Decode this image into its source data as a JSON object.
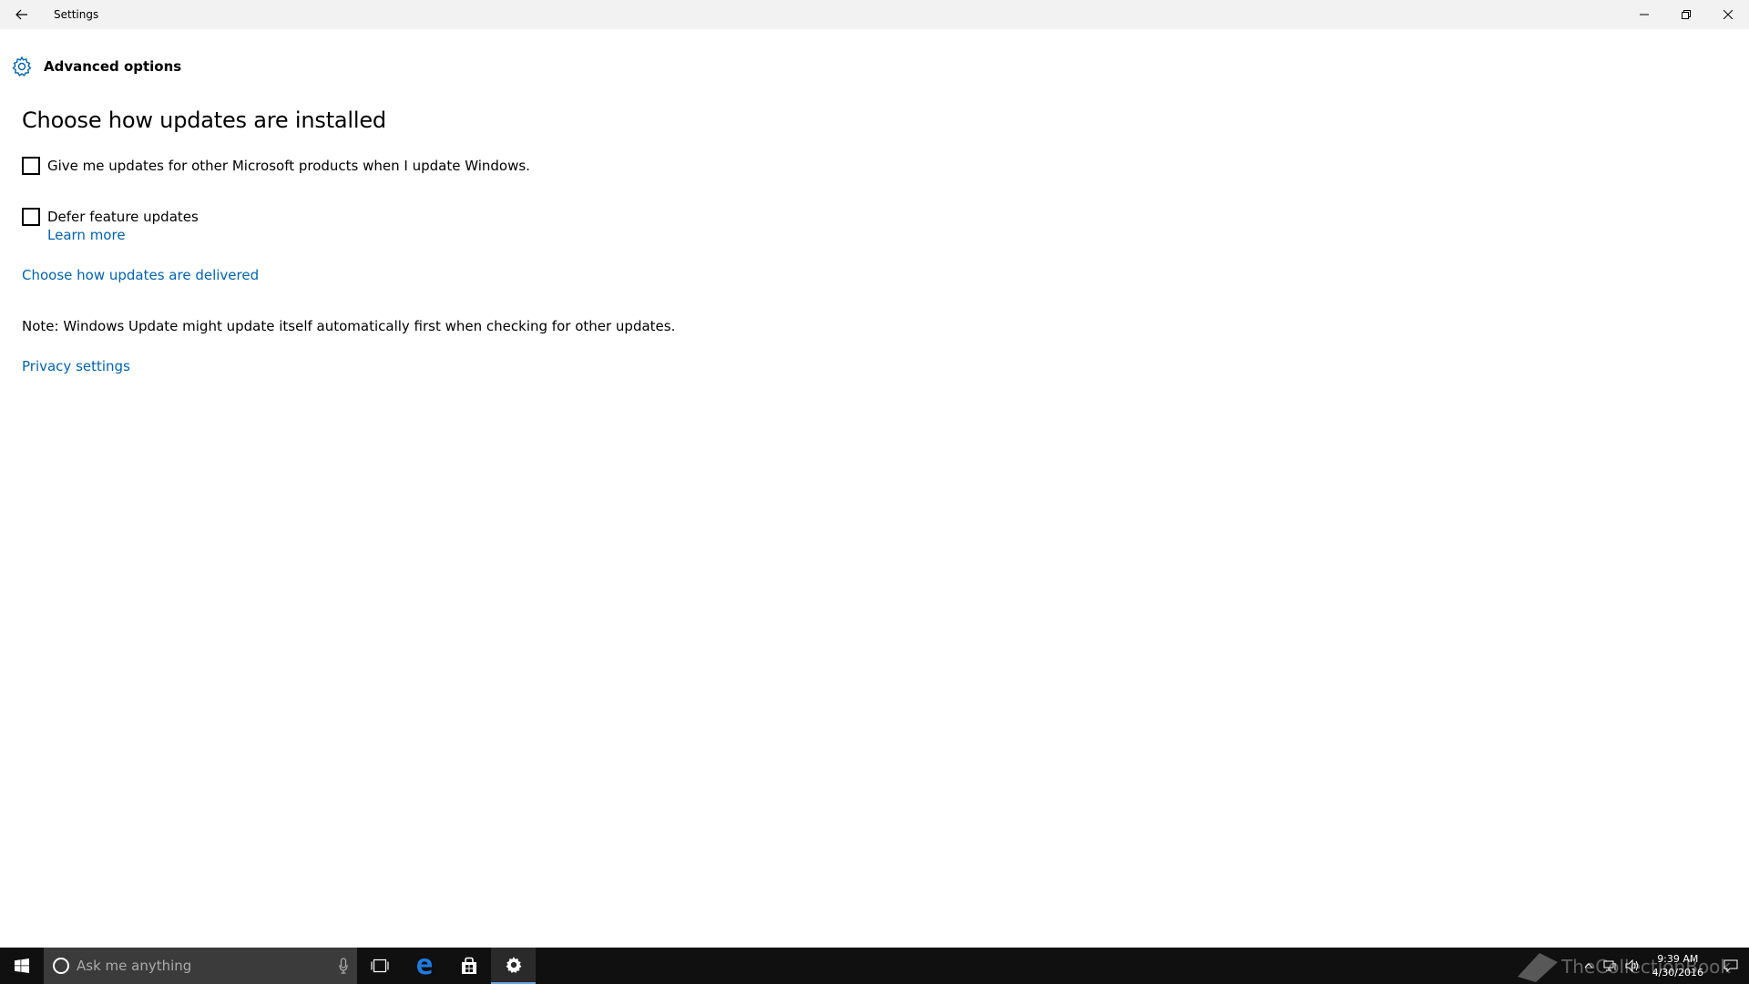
{
  "window": {
    "title": "Settings"
  },
  "header": {
    "title": "Advanced options",
    "icon": "gear-icon"
  },
  "main": {
    "section_title": "Choose how updates are installed",
    "options": [
      {
        "label": "Give me updates for other Microsoft products when I update Windows.",
        "checked": false
      },
      {
        "label": "Defer feature updates",
        "checked": false
      }
    ],
    "learn_more": "Learn more",
    "delivery_link": "Choose how updates are delivered",
    "note": "Note: Windows Update might update itself automatically first when checking for other updates.",
    "privacy_link": "Privacy settings"
  },
  "taskbar": {
    "search_placeholder": "Ask me anything",
    "clock_time": "9:39 AM",
    "clock_date": "4/30/2016",
    "watermark": "TheCollectionBook"
  },
  "colors": {
    "accent": "#0063b1",
    "taskbar": "#101010",
    "search_box": "#3b3b3b",
    "titlebar": "#f2f2f2"
  }
}
